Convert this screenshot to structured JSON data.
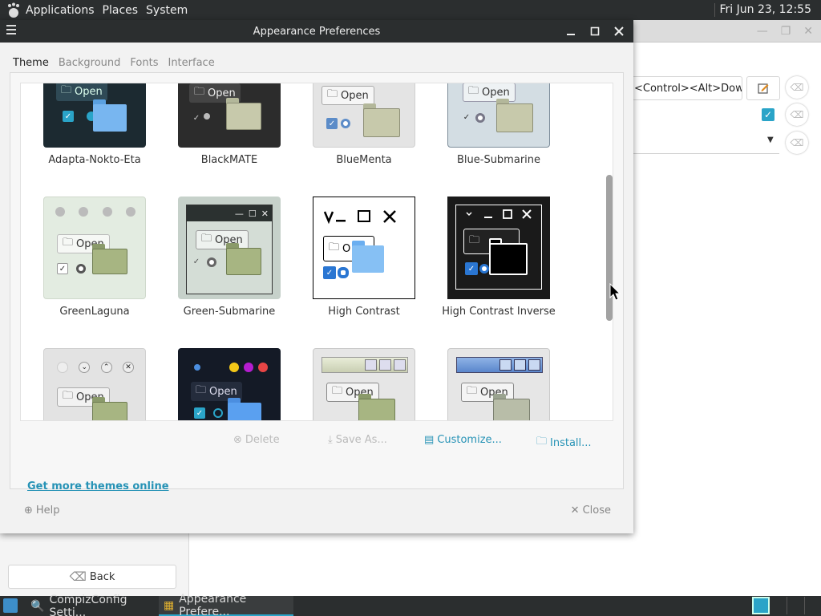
{
  "top_panel": {
    "menus": [
      "Applications",
      "Places",
      "System"
    ],
    "clock": "Fri Jun 23, 12:55"
  },
  "background_window": {
    "keybinding": "<Control><Alt>Down",
    "back_label": "Back"
  },
  "dialog": {
    "title": "Appearance Preferences",
    "tabs": [
      "Theme",
      "Background",
      "Fonts",
      "Interface"
    ],
    "active_tab": "Theme",
    "open_label": "Open",
    "themes": [
      "Adapta-Nokto-Eta",
      "BlackMATE",
      "BlueMenta",
      "Blue-Submarine",
      "GreenLaguna",
      "Green-Submarine",
      "High Contrast",
      "High Contrast Inverse",
      "",
      "",
      "",
      ""
    ],
    "actions": {
      "delete": "Delete",
      "save_as": "Save As...",
      "customize": "Customize...",
      "install": "Install..."
    },
    "get_more_link": "Get more themes online",
    "help": "Help",
    "close": "Close",
    "accent_color": "#2aa4c8",
    "link_color": "#2793b6"
  },
  "taskbar": {
    "tasks": [
      "CompizConfig Setti...",
      "Appearance Prefere..."
    ],
    "active_task": "Appearance Prefere..."
  }
}
